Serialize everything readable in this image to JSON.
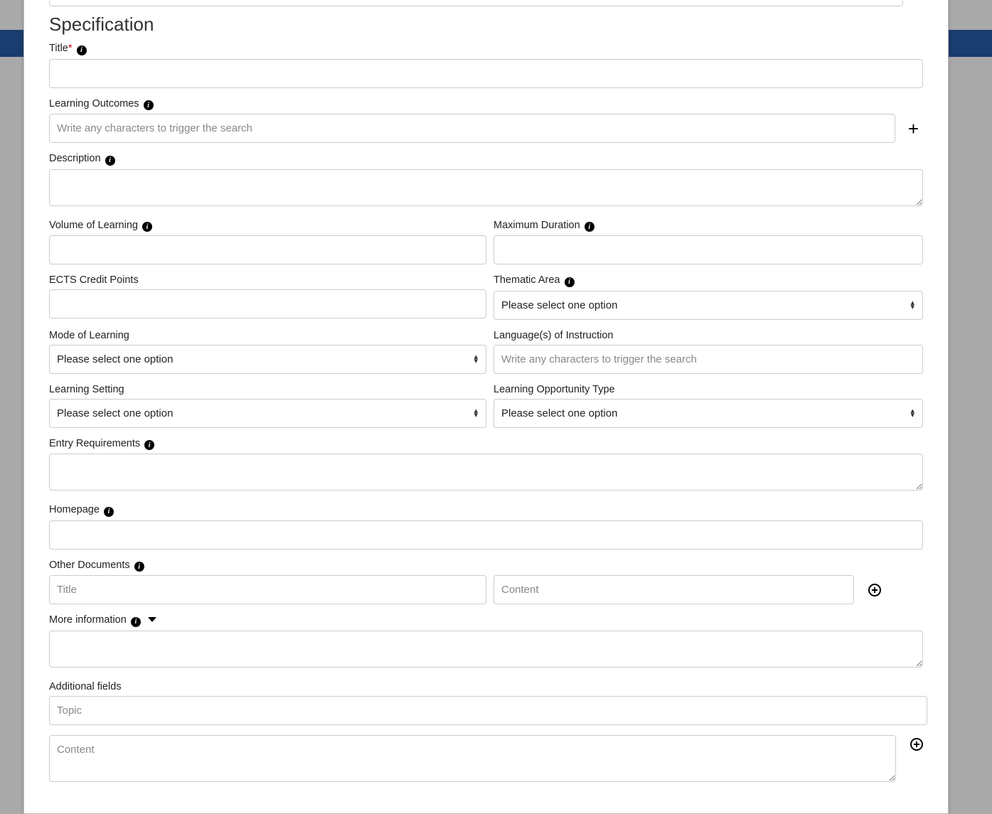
{
  "section_title": "Specification",
  "labels": {
    "title": "Title",
    "learning_outcomes": "Learning Outcomes",
    "description": "Description",
    "volume_of_learning": "Volume of Learning",
    "maximum_duration": "Maximum Duration",
    "ects": "ECTS Credit Points",
    "thematic_area": "Thematic Area",
    "mode_of_learning": "Mode of Learning",
    "languages": "Language(s) of Instruction",
    "learning_setting": "Learning Setting",
    "opportunity_type": "Learning Opportunity Type",
    "entry_requirements": "Entry Requirements",
    "homepage": "Homepage",
    "other_documents": "Other Documents",
    "more_information": "More information",
    "additional_fields": "Additional fields"
  },
  "placeholders": {
    "search_trigger": "Write any characters to trigger the search",
    "title_doc": "Title",
    "content": "Content",
    "topic": "Topic"
  },
  "select_default": "Please select one option"
}
